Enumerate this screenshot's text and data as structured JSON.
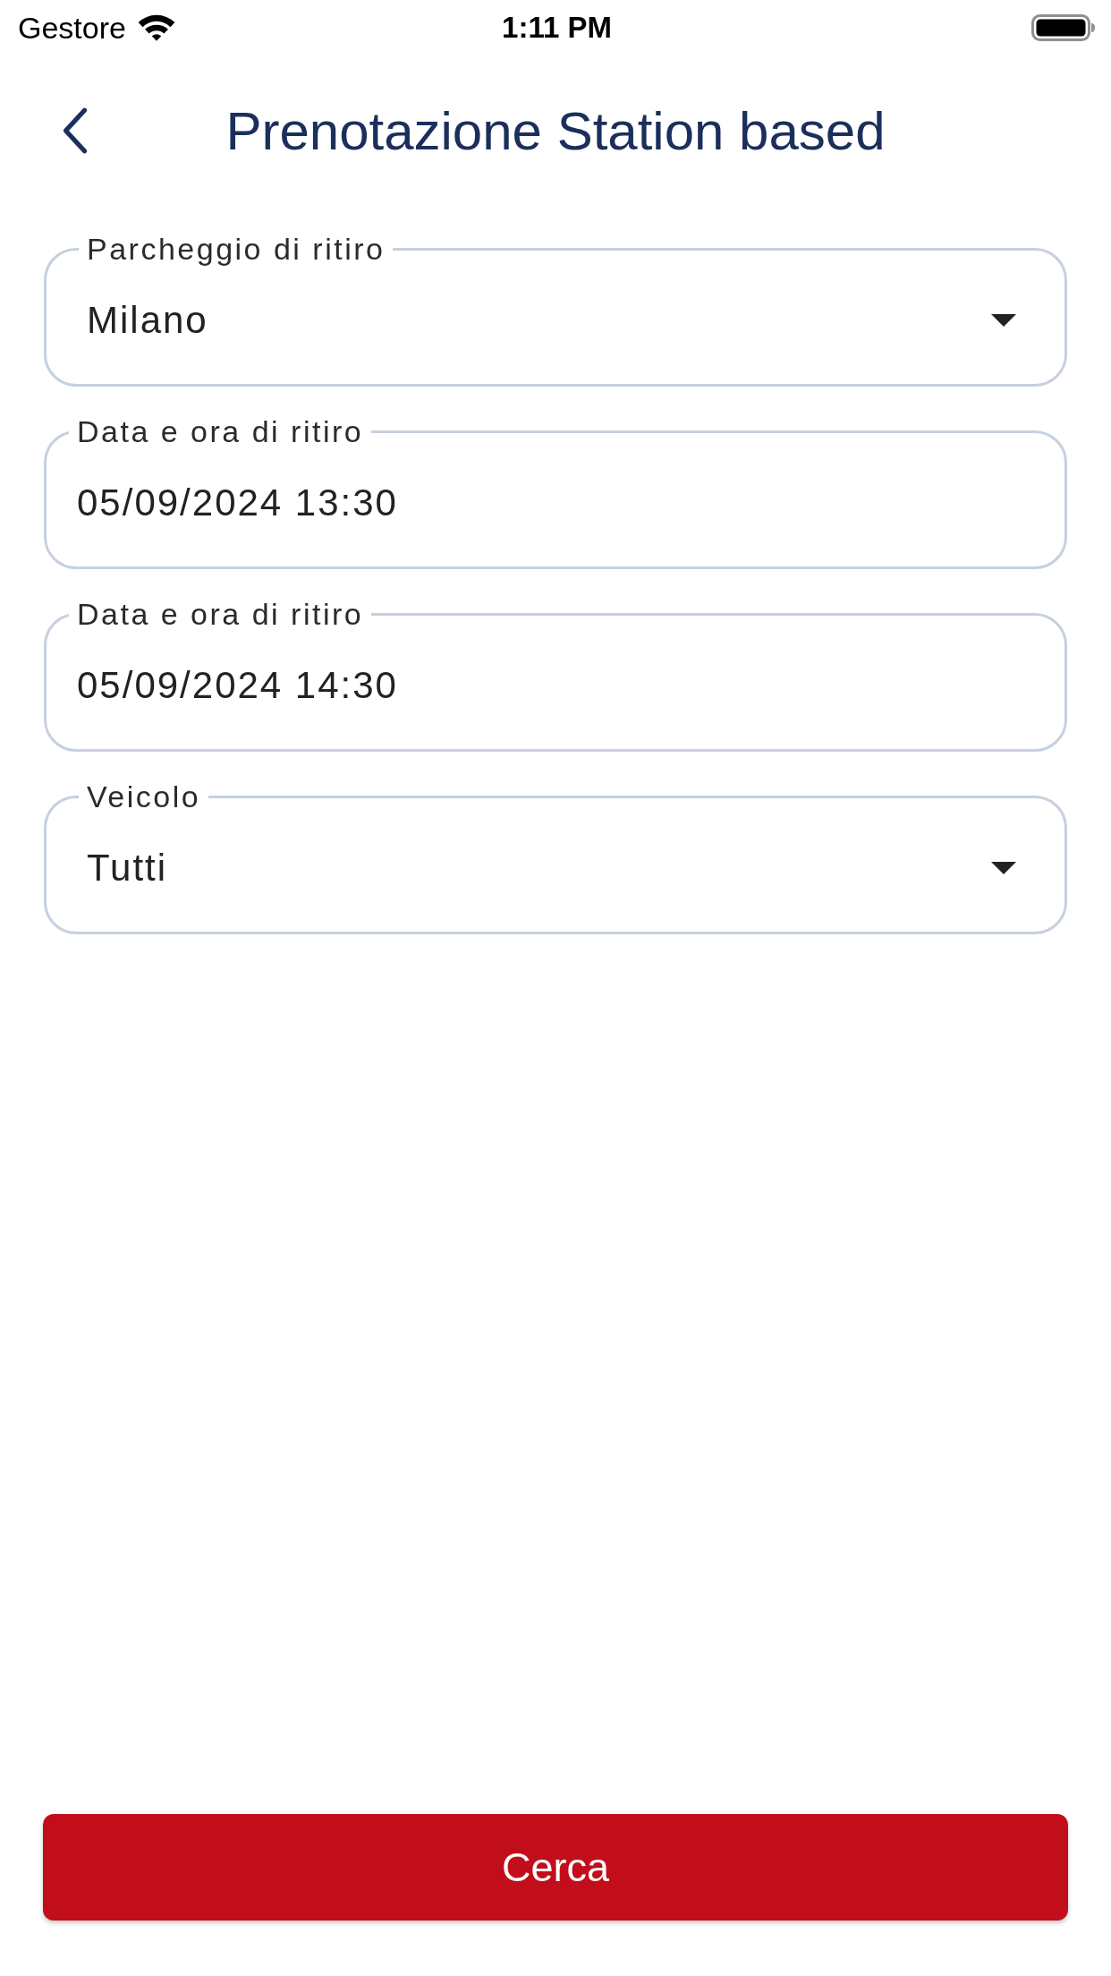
{
  "status_bar": {
    "carrier": "Gestore",
    "time": "1:11 PM"
  },
  "header": {
    "title": "Prenotazione Station based"
  },
  "fields": [
    {
      "kind": "dropdown",
      "label": "Parcheggio di ritiro",
      "value": "Milano"
    },
    {
      "kind": "date",
      "label": "Data e ora di ritiro",
      "value": "05/09/2024 13:30"
    },
    {
      "kind": "date",
      "label": "Data e ora di ritiro",
      "value": "05/09/2024 14:30"
    },
    {
      "kind": "dropdown",
      "label": "Veicolo",
      "value": "Tutti"
    }
  ],
  "button": {
    "label": "Cerca"
  }
}
